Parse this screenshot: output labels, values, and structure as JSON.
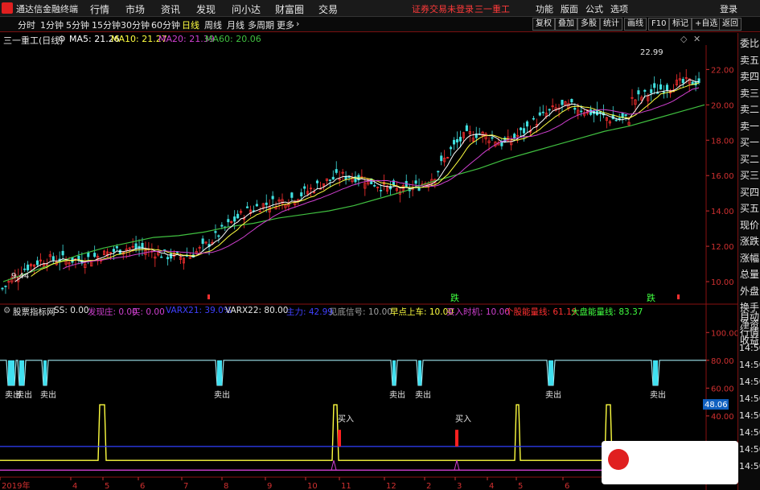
{
  "app": {
    "title": "通达信金融终端",
    "notice": "证券交易未登录",
    "stock_top": "三一重工"
  },
  "menu": [
    "行情",
    "市场",
    "资讯",
    "发现",
    "问小达",
    "财富圈",
    "交易"
  ],
  "right_menu": [
    "功能",
    "版面",
    "公式",
    "选项",
    "登录"
  ],
  "timeframes": [
    "分时",
    "1分钟",
    "5分钟",
    "15分钟",
    "30分钟",
    "60分钟",
    "日线",
    "周线",
    "月线",
    "多周期",
    "更多"
  ],
  "active_timeframe": "日线",
  "toolbar_buttons": [
    "复权",
    "叠加",
    "多股",
    "统计",
    "画线",
    "F10",
    "标记",
    "+自选",
    "返回"
  ],
  "ma": {
    "stock": "三一重工(日线)",
    "ma5": "MA5: 21.26",
    "ma10": "MA10: 21.27",
    "ma20": "MA20: 21.39",
    "ma60": "MA60: 20.06"
  },
  "colors": {
    "ma5": "#ffffff",
    "ma10": "#ffff40",
    "ma20": "#d040d0",
    "ma60": "#40c040",
    "up": "#ff3030",
    "down": "#40e0e0"
  },
  "right_labels": [
    "委比",
    "卖五",
    "卖四",
    "卖三",
    "卖二",
    "卖一",
    "买一",
    "买二",
    "买三",
    "买四",
    "买五",
    "现价",
    "涨跌",
    "涨幅",
    "总量",
    "外盘",
    "换手",
    "净资",
    "收益",
    "自动",
    "行情"
  ],
  "right_times": [
    "14:50",
    "14:50",
    "14:50",
    "14:50",
    "14:50",
    "14:50",
    "14:50",
    "14:50"
  ],
  "indicator": {
    "name": "股票指标网",
    "items": [
      {
        "t": "SS: 0.00",
        "c": "#e6e6e6"
      },
      {
        "t": "发现庄: 0.00",
        "c": "#d040d0"
      },
      {
        "t": "买: 0.00",
        "c": "#d040d0"
      },
      {
        "t": "VARX21: 39.0%",
        "c": "#4040ff"
      },
      {
        "t": "VARX22: 80.00",
        "c": "#e6e6e6"
      },
      {
        "t": "主力: 42.99",
        "c": "#4040ff"
      },
      {
        "t": "见底信号: 10.00",
        "c": "#a0a0a0"
      },
      {
        "t": "早点上车: 10.00",
        "c": "#ffff40"
      },
      {
        "t": "买入时机: 10.00",
        "c": "#d040d0"
      },
      {
        "t": "个股能量线: 61.19",
        "c": "#ff3030"
      },
      {
        "t": "大盘能量线: 83.37",
        "c": "#40ff40"
      }
    ],
    "sell_label": "卖出",
    "buy_label": "买入",
    "value_badge": "48.06"
  },
  "chart_data": {
    "type": "line",
    "title": "",
    "price_ticks": [
      "22.00",
      "20.00",
      "18.00",
      "16.00",
      "14.00",
      "12.00",
      "10.00"
    ],
    "price_range": [
      9.0,
      23.2
    ],
    "max_label": "22.99",
    "min_label": "9.44",
    "ind_ticks": [
      "100.00",
      "80.00",
      "60.00",
      "40.00"
    ],
    "date_labels": [
      "2019年",
      "4",
      "5",
      "6",
      "7",
      "8",
      "9",
      "10",
      "11",
      "12",
      "2",
      "3",
      "4",
      "5",
      "6",
      "2019年"
    ],
    "signal_marks": [
      "跌",
      "跌"
    ],
    "ma60": [
      10.0,
      10.5,
      11.0,
      11.5,
      11.9,
      12.2,
      12.5,
      12.6,
      12.8,
      13.1,
      13.3,
      13.6,
      13.8,
      14.0,
      14.3,
      14.7,
      15.1,
      15.6,
      16.0,
      16.4,
      16.9,
      17.3,
      17.7,
      18.1,
      18.5,
      18.8,
      19.2,
      19.6,
      20.0
    ]
  }
}
